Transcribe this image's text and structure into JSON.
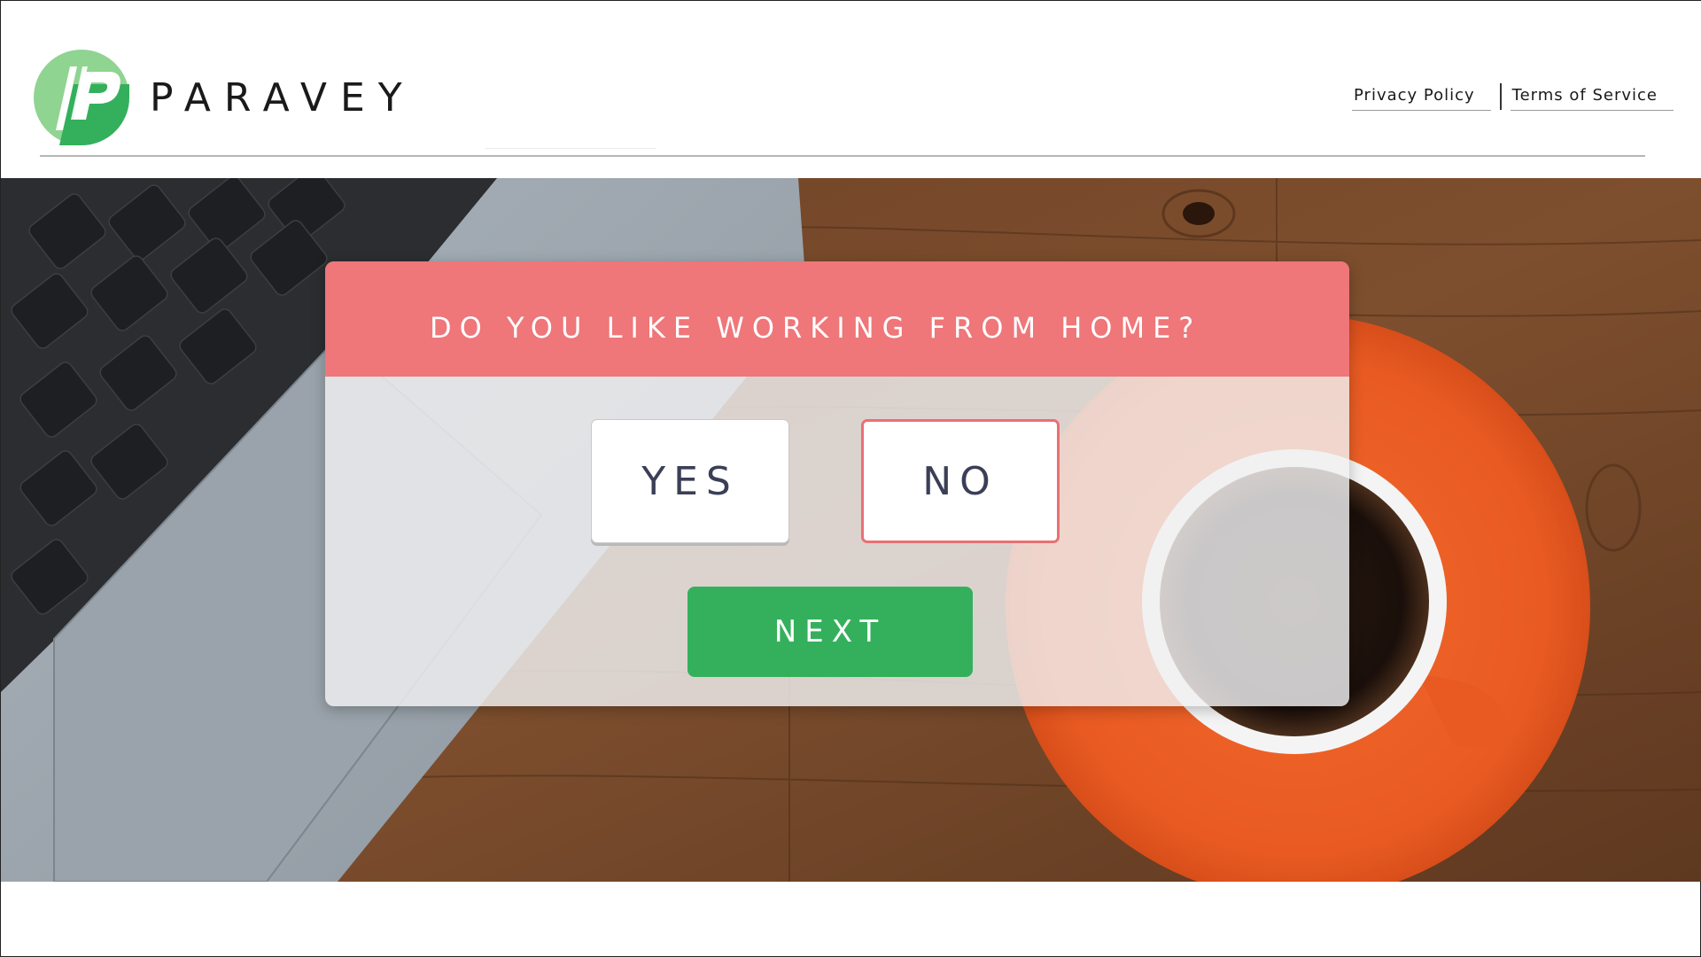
{
  "brand": {
    "logo_icon": "paravey-logo-icon",
    "name": "PARAVEY",
    "colors": {
      "logo_light": "#8fd491",
      "logo_dark": "#34b05c"
    }
  },
  "header": {
    "links": [
      {
        "label": "Privacy Policy"
      },
      {
        "label": "Terms of Service"
      }
    ]
  },
  "survey": {
    "question": "DO YOU LIKE WORKING FROM HOME?",
    "answers": {
      "yes": "YES",
      "no": "NO"
    },
    "selected": "no",
    "next_label": "NEXT",
    "colors": {
      "header_bg": "#ef7679",
      "next_bg": "#34b05c",
      "answer_text": "#3b3f56",
      "selected_border": "#ea6f73"
    }
  },
  "hero": {
    "background_icon": "laptop-and-coffee-photo"
  }
}
